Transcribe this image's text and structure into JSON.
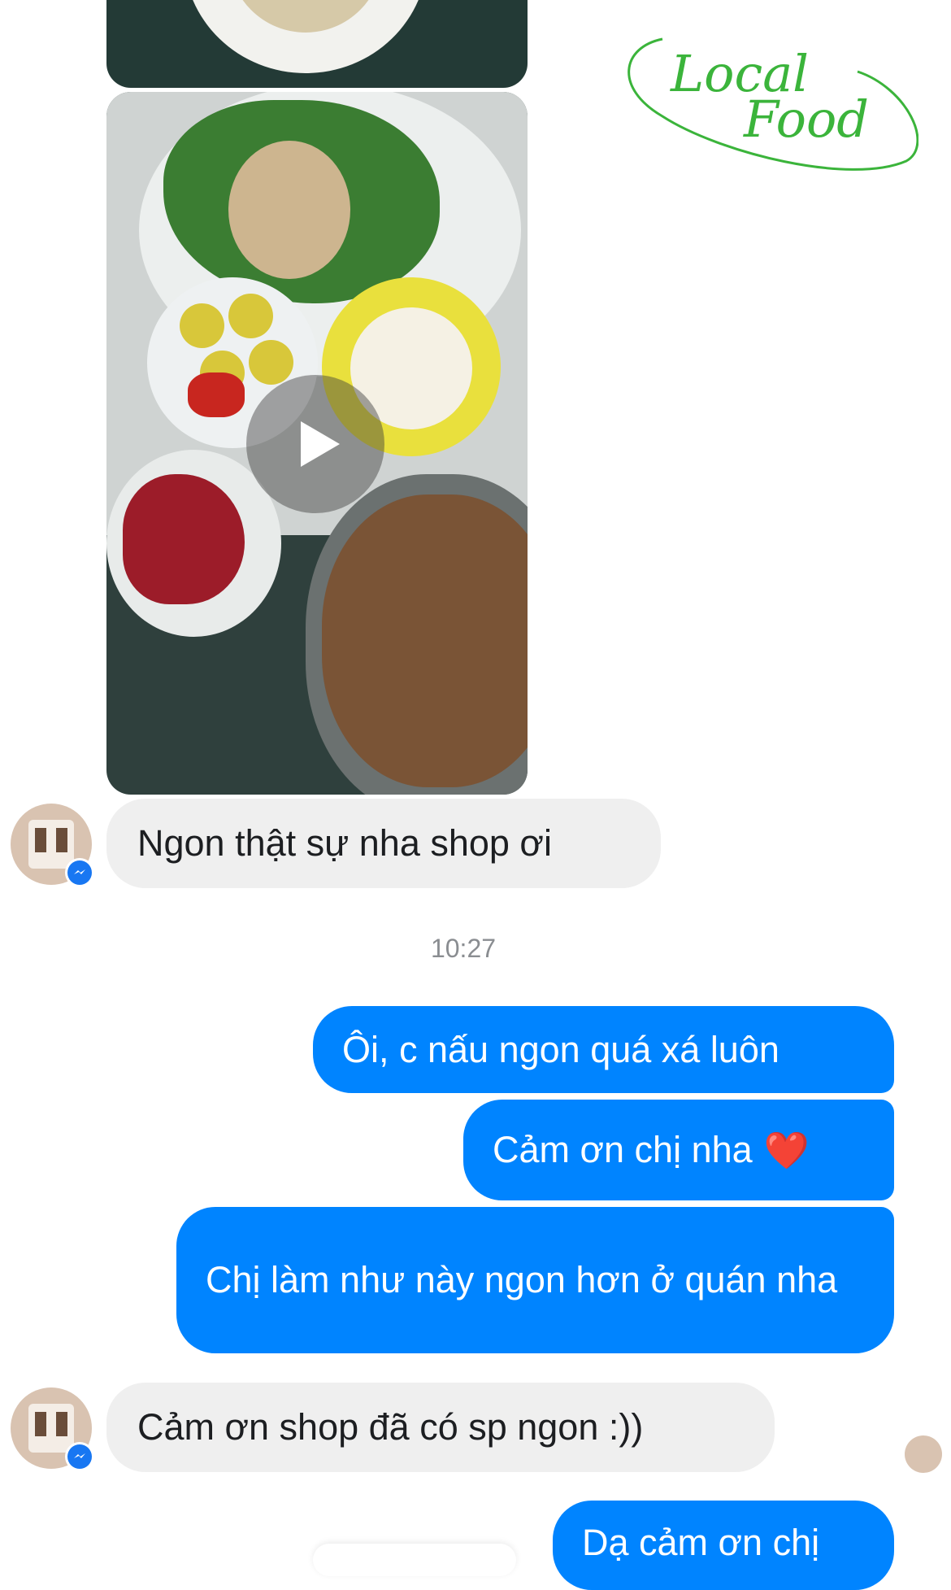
{
  "logo": {
    "line1": "Local",
    "line2": "Food",
    "color": "#3bb43b"
  },
  "media": {
    "play_icon": "play-icon"
  },
  "messages": {
    "incoming_1": "Ngon thật sự nha shop ơi",
    "timestamp": "10:27",
    "outgoing_1": "Ôi, c nấu ngon quá xá luôn",
    "outgoing_2": "Cảm ơn chị nha",
    "outgoing_2_emoji": "❤️",
    "outgoing_3": "Chị làm như này ngon hơn ở quán nha",
    "incoming_2": "Cảm ơn shop đã có sp ngon :))",
    "outgoing_4": "Dạ cảm ơn chị"
  },
  "colors": {
    "outgoing_bubble": "#0084ff",
    "incoming_bubble": "#efefef",
    "messenger_badge": "#1877f2"
  }
}
